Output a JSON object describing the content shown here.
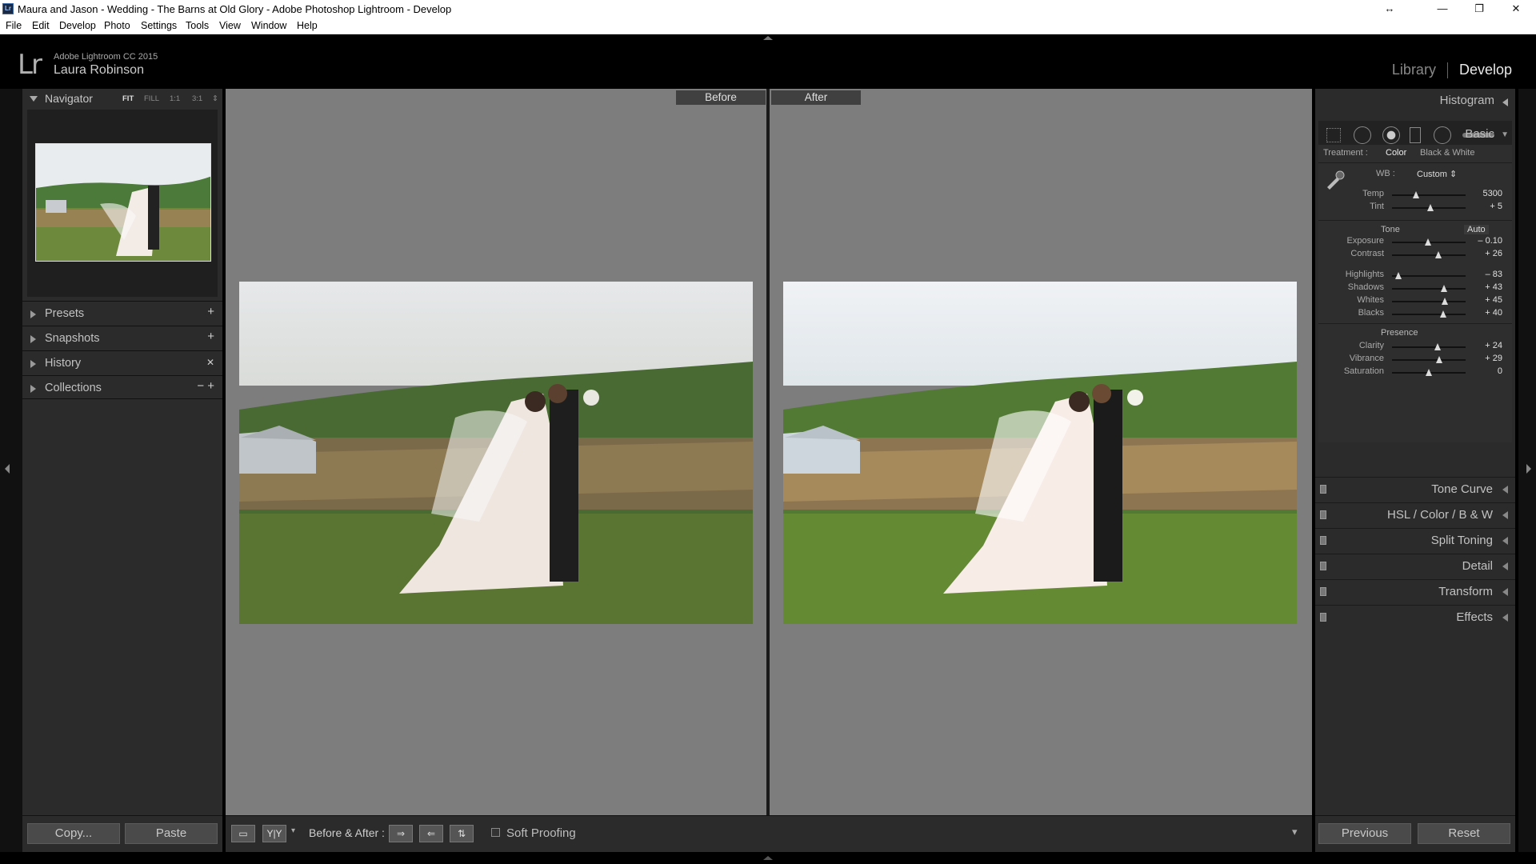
{
  "window": {
    "title": "Maura and Jason - Wedding - The Barns at Old Glory - Adobe Photoshop Lightroom - Develop",
    "app_icon": "Lr",
    "controls": [
      "↔",
      "—",
      "❐",
      "✕"
    ]
  },
  "menubar": {
    "items": [
      "File",
      "Edit",
      "Develop",
      "Photo",
      "Settings",
      "Tools",
      "View",
      "Window",
      "Help"
    ]
  },
  "identity": {
    "logo": "Lr",
    "version": "Adobe Lightroom CC 2015",
    "user": "Laura Robinson",
    "modules": [
      "Library",
      "Develop"
    ],
    "active_module": "Develop"
  },
  "navigator": {
    "title": "Navigator",
    "zoom_options": [
      "FIT",
      "FILL",
      "1:1",
      "3:1"
    ],
    "zoom_selected": "FIT",
    "stepper": "⇕"
  },
  "left_sections": [
    {
      "label": "Presets",
      "action": "+"
    },
    {
      "label": "Snapshots",
      "action": "+"
    },
    {
      "label": "History",
      "action": "✕"
    },
    {
      "label": "Collections",
      "action": "− +"
    }
  ],
  "left_buttons": {
    "copy": "Copy...",
    "paste": "Paste"
  },
  "compare": {
    "before_label": "Before",
    "after_label": "After"
  },
  "toolbar": {
    "view_icon": "▭",
    "yy_icon": "Y|Y",
    "yy_chevron": "▾",
    "mode_label": "Before & After :",
    "swap_icons": [
      "⇒",
      "⇐",
      "⇅"
    ],
    "soft_proofing": "Soft Proofing",
    "menu_icon": "▾"
  },
  "right_panel": {
    "histogram": "Histogram",
    "basic": "Basic",
    "treatment_label": "Treatment :",
    "treatment_options": [
      "Color",
      "Black & White"
    ],
    "treatment_selected": "Color",
    "wb_label": "WB :",
    "wb_value": "Custom ⇕",
    "wb_sliders": [
      {
        "label": "Temp",
        "value": "5300",
        "pos": 0.33
      },
      {
        "label": "Tint",
        "value": "+ 5",
        "pos": 0.52
      }
    ],
    "tone_label": "Tone",
    "auto_label": "Auto",
    "tone_sliders": [
      {
        "label": "Exposure",
        "value": "– 0.10",
        "pos": 0.49
      },
      {
        "label": "Contrast",
        "value": "+ 26",
        "pos": 0.63
      }
    ],
    "tone_sliders2": [
      {
        "label": "Highlights",
        "value": "– 83",
        "pos": 0.09
      },
      {
        "label": "Shadows",
        "value": "+ 43",
        "pos": 0.71
      },
      {
        "label": "Whites",
        "value": "+ 45",
        "pos": 0.72
      },
      {
        "label": "Blacks",
        "value": "+ 40",
        "pos": 0.7
      }
    ],
    "presence_label": "Presence",
    "presence_sliders": [
      {
        "label": "Clarity",
        "value": "+ 24",
        "pos": 0.62
      },
      {
        "label": "Vibrance",
        "value": "+ 29",
        "pos": 0.64
      },
      {
        "label": "Saturation",
        "value": "0",
        "pos": 0.5
      }
    ],
    "panels": [
      {
        "label": "Tone Curve"
      },
      {
        "label": "HSL / Color / B & W"
      },
      {
        "label": "Split Toning"
      },
      {
        "label": "Detail"
      },
      {
        "label": "Transform"
      },
      {
        "label": "Effects"
      }
    ],
    "previous": "Previous",
    "reset": "Reset"
  }
}
